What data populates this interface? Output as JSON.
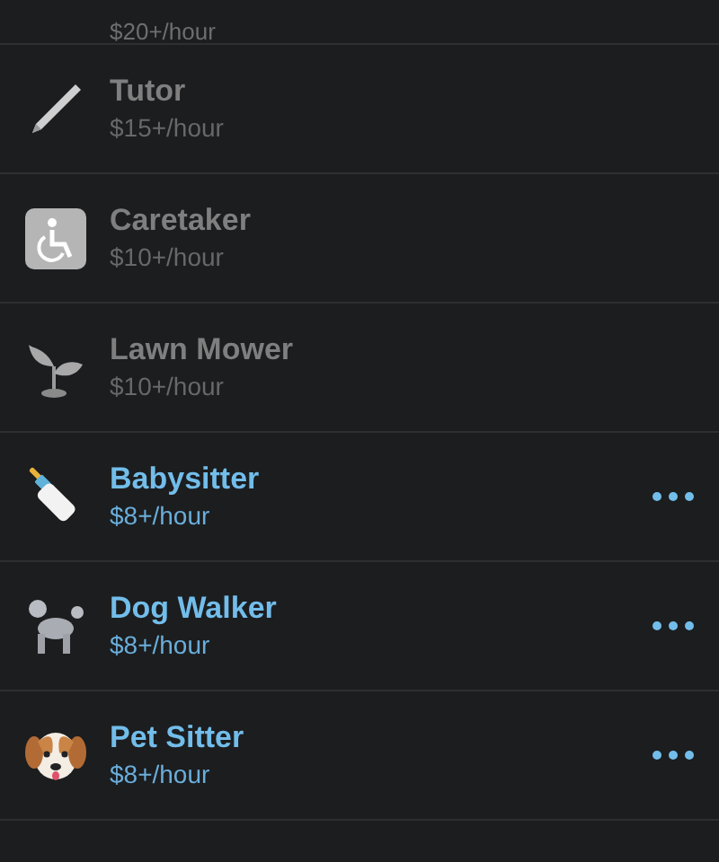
{
  "partial_row": {
    "price": "$20+/hour"
  },
  "jobs": [
    {
      "title": "Tutor",
      "price": "$15+/hour",
      "disabled": true
    },
    {
      "title": "Caretaker",
      "price": "$10+/hour",
      "disabled": true
    },
    {
      "title": "Lawn Mower",
      "price": "$10+/hour",
      "disabled": true
    },
    {
      "title": "Babysitter",
      "price": "$8+/hour",
      "disabled": false
    },
    {
      "title": "Dog Walker",
      "price": "$8+/hour",
      "disabled": false
    },
    {
      "title": "Pet Sitter",
      "price": "$8+/hour",
      "disabled": false
    }
  ]
}
